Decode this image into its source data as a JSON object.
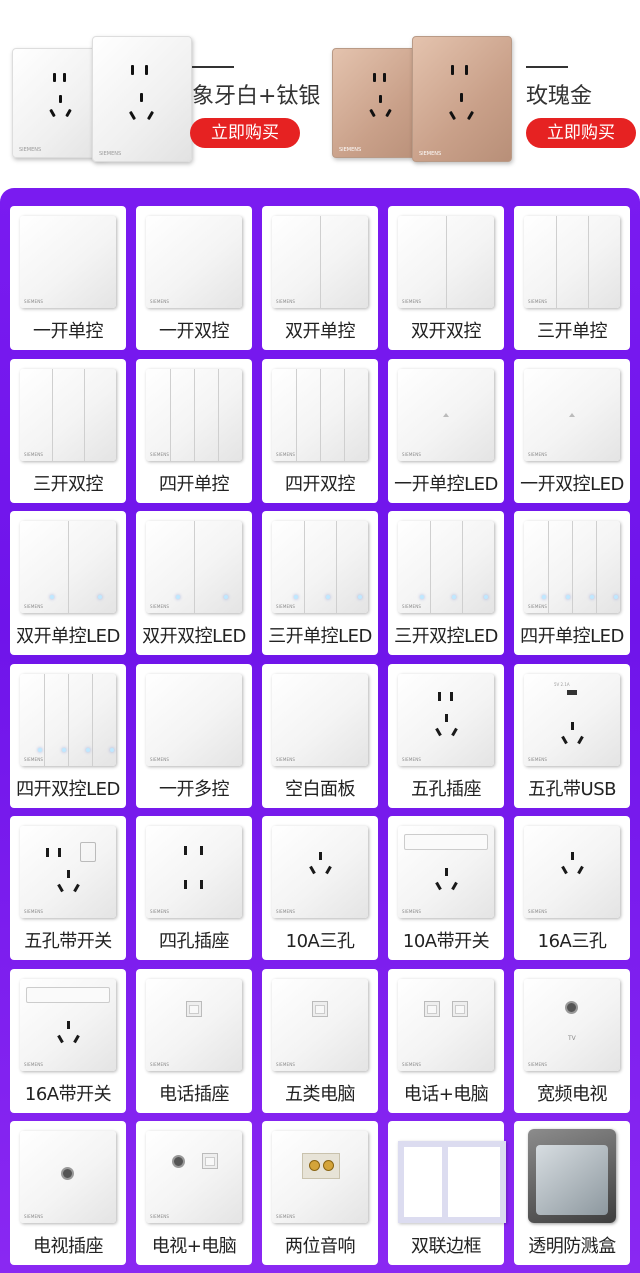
{
  "variants": [
    {
      "name": "象牙白+钛银",
      "buy_label": "立即购买"
    },
    {
      "name": "玫瑰金",
      "buy_label": "立即购买"
    }
  ],
  "brand_mark": "SIEMENS",
  "products": [
    {
      "label": "一开单控",
      "kind": "switch",
      "gangs": 1,
      "led": false
    },
    {
      "label": "一开双控",
      "kind": "switch",
      "gangs": 1,
      "led": false
    },
    {
      "label": "双开单控",
      "kind": "switch",
      "gangs": 2,
      "led": false
    },
    {
      "label": "双开双控",
      "kind": "switch",
      "gangs": 2,
      "led": false
    },
    {
      "label": "三开单控",
      "kind": "switch",
      "gangs": 3,
      "led": false
    },
    {
      "label": "三开双控",
      "kind": "switch",
      "gangs": 3,
      "led": false
    },
    {
      "label": "四开单控",
      "kind": "switch",
      "gangs": 4,
      "led": false
    },
    {
      "label": "四开双控",
      "kind": "switch",
      "gangs": 4,
      "led": false
    },
    {
      "label": "一开单控LED",
      "kind": "switch",
      "gangs": 1,
      "led": true
    },
    {
      "label": "一开双控LED",
      "kind": "switch",
      "gangs": 1,
      "led": true
    },
    {
      "label": "双开单控LED",
      "kind": "switch",
      "gangs": 2,
      "led": true
    },
    {
      "label": "双开双控LED",
      "kind": "switch",
      "gangs": 2,
      "led": true
    },
    {
      "label": "三开单控LED",
      "kind": "switch",
      "gangs": 3,
      "led": true
    },
    {
      "label": "三开双控LED",
      "kind": "switch",
      "gangs": 3,
      "led": true
    },
    {
      "label": "四开单控LED",
      "kind": "switch",
      "gangs": 4,
      "led": true
    },
    {
      "label": "四开双控LED",
      "kind": "switch",
      "gangs": 4,
      "led": true
    },
    {
      "label": "一开多控",
      "kind": "switch",
      "gangs": 1,
      "led": false
    },
    {
      "label": "空白面板",
      "kind": "blank"
    },
    {
      "label": "五孔插座",
      "kind": "five-hole"
    },
    {
      "label": "五孔带USB",
      "kind": "five-hole-usb"
    },
    {
      "label": "五孔带开关",
      "kind": "five-hole-switch"
    },
    {
      "label": "四孔插座",
      "kind": "four-hole"
    },
    {
      "label": "10A三孔",
      "kind": "three-hole"
    },
    {
      "label": "10A带开关",
      "kind": "three-hole-switch"
    },
    {
      "label": "16A三孔",
      "kind": "three-hole"
    },
    {
      "label": "16A带开关",
      "kind": "three-hole-switch-big"
    },
    {
      "label": "电话插座",
      "kind": "phone"
    },
    {
      "label": "五类电脑",
      "kind": "data"
    },
    {
      "label": "电话+电脑",
      "kind": "phone-data"
    },
    {
      "label": "宽频电视",
      "kind": "tv-broadband"
    },
    {
      "label": "电视插座",
      "kind": "tv"
    },
    {
      "label": "电视+电脑",
      "kind": "tv-data"
    },
    {
      "label": "两位音响",
      "kind": "speaker"
    },
    {
      "label": "双联边框",
      "kind": "frame"
    },
    {
      "label": "透明防溅盒",
      "kind": "splash-box"
    }
  ],
  "tv_mark": "TV",
  "usb_mark": "5V 2.1A"
}
